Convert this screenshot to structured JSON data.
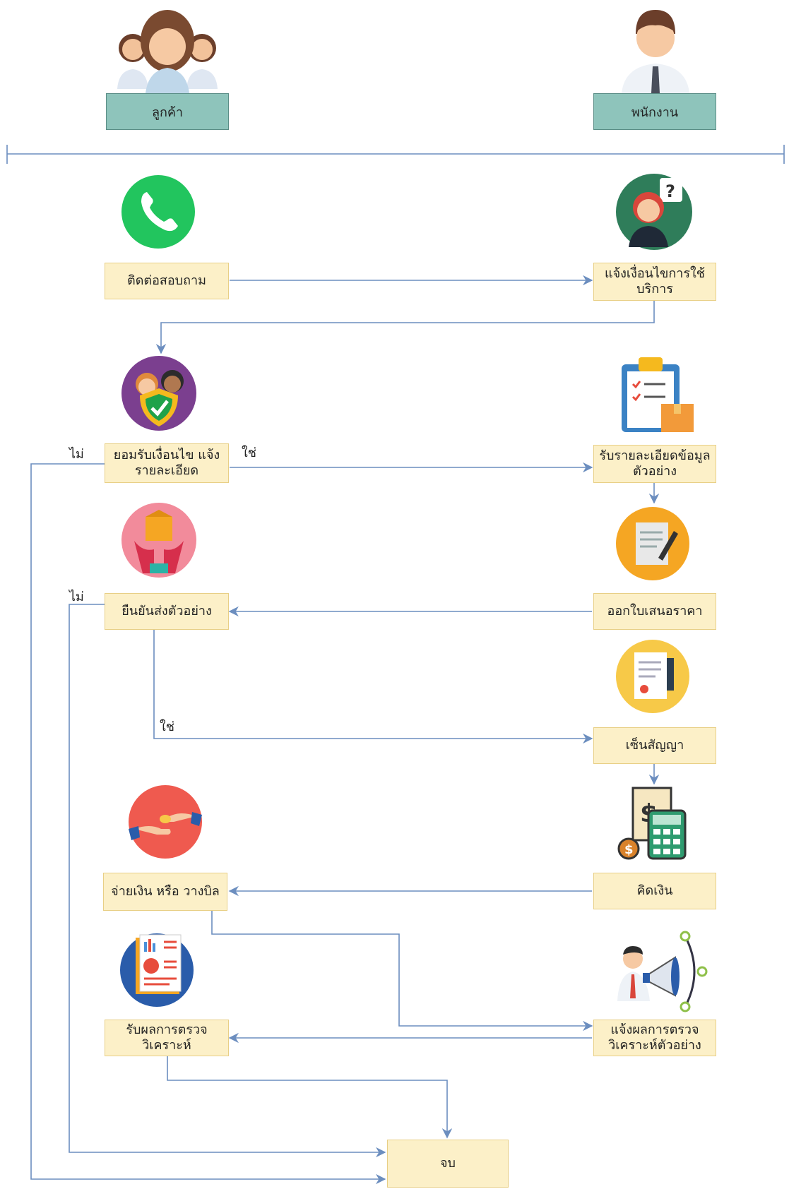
{
  "roles": {
    "customer": "ลูกค้า",
    "staff": "พนักงาน"
  },
  "nodes": {
    "contact": "ติดต่อสอบถาม",
    "notify_terms": "แจ้งเงื่อนไขการใช้บริการ",
    "accept_terms": "ยอมรับเงื่อนไข แจ้งรายละเอียด",
    "receive_details": "รับรายละเอียดข้อมูลตัวอย่าง",
    "confirm_send": "ยืนยันส่งตัวอย่าง",
    "quotation": "ออกใบเสนอราคา",
    "sign_contract": "เซ็นสัญญา",
    "calculate": "คิดเงิน",
    "pay": "จ่ายเงิน หรือ วางบิล",
    "notify_result": "แจ้งผลการตรวจวิเคราะห์ตัวอย่าง",
    "receive_result": "รับผลการตรวจวิเคราะห์",
    "end": "จบ"
  },
  "edge_labels": {
    "no1": "ไม่",
    "yes1": "ใช่",
    "no2": "ไม่",
    "yes2": "ใช่"
  },
  "colors": {
    "node_fill": "#fcf0c8",
    "role_fill": "#8ec4bb",
    "edge": "#6c8ebf"
  }
}
